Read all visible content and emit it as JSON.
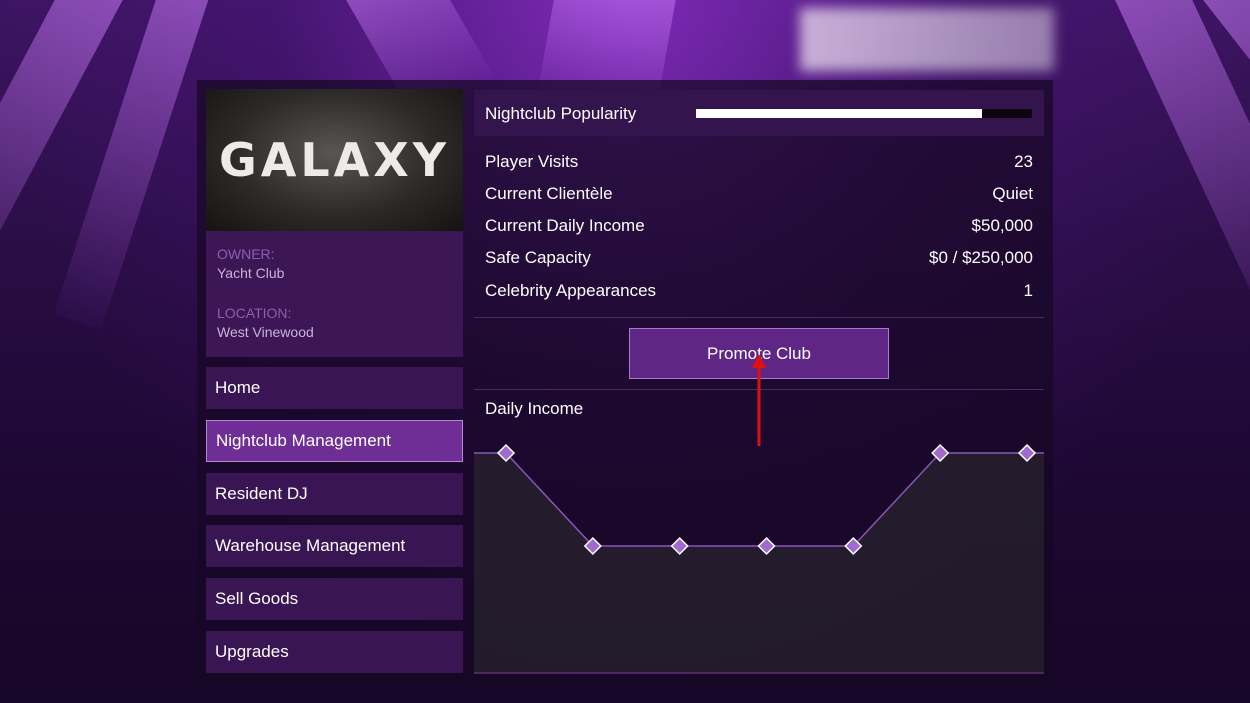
{
  "club": {
    "logo_text": "GALAXY",
    "owner_label": "OWNER:",
    "owner_value": "Yacht Club",
    "location_label": "LOCATION:",
    "location_value": "West Vinewood"
  },
  "nav": {
    "items": [
      {
        "label": "Home",
        "active": false
      },
      {
        "label": "Nightclub Management",
        "active": true
      },
      {
        "label": "Resident DJ",
        "active": false
      },
      {
        "label": "Warehouse Management",
        "active": false
      },
      {
        "label": "Sell Goods",
        "active": false
      },
      {
        "label": "Upgrades",
        "active": false
      }
    ]
  },
  "popularity": {
    "label": "Nightclub Popularity",
    "level": 0.85
  },
  "stats": [
    {
      "label": "Player Visits",
      "value": "23"
    },
    {
      "label": "Current Clientèle",
      "value": "Quiet"
    },
    {
      "label": "Current Daily Income",
      "value": "$50,000"
    },
    {
      "label": "Safe Capacity",
      "value": "$0 / $250,000"
    },
    {
      "label": "Celebrity Appearances",
      "value": "1"
    }
  ],
  "promote_button": {
    "label": "Promote Club"
  },
  "income_chart_label": "Daily Income",
  "chart_data": {
    "type": "area",
    "title": "Daily Income",
    "x": [
      1,
      2,
      3,
      4,
      5,
      6,
      7
    ],
    "values": [
      1,
      0.5,
      0.5,
      0.5,
      0.5,
      1,
      1
    ],
    "ylim": [
      0,
      1.15
    ],
    "grid": false
  },
  "colors": {
    "accent": "#6e2e96",
    "arrow": "#e01010",
    "chart_line": "#8a55b8",
    "marker": "#a06ad0"
  },
  "icons": {
    "cursor": "hand-pointer-icon",
    "annotation": "red-arrow-icon"
  }
}
